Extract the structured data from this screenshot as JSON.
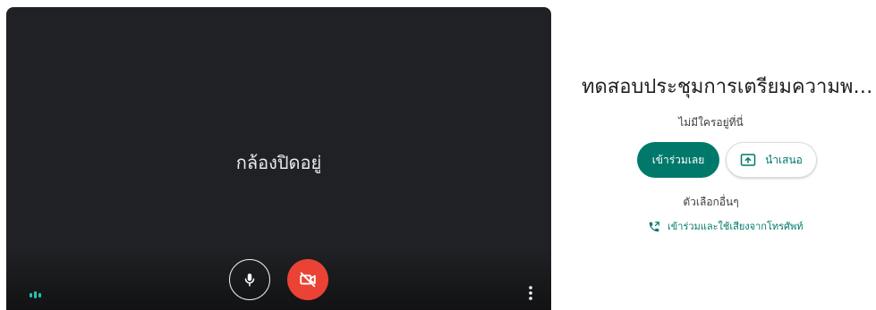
{
  "preview": {
    "camera_off_text": "กล้องปิดอยู่"
  },
  "panel": {
    "meeting_title": "ทดสอบประชุมการเตรียมความพร้...",
    "no_one_here": "ไม่มีใครอยู่ที่นี่",
    "join_label": "เข้าร่วมเลย",
    "present_label": "นำเสนอ",
    "other_options": "ตัวเลือกอื่นๆ",
    "phone_join_label": "เข้าร่วมและใช้เสียงจากโทรศัพท์"
  },
  "icons": {
    "mic": "microphone-icon",
    "camera_off": "camera-off-icon",
    "more": "more-vert-icon",
    "present": "present-screen-icon",
    "phone": "phone-forward-icon",
    "audio": "audio-level-icon"
  },
  "colors": {
    "accent": "#00796b",
    "camera_off_button": "#ea4335",
    "preview_bg": "#202124",
    "audio_level": "#1ec4b0"
  }
}
